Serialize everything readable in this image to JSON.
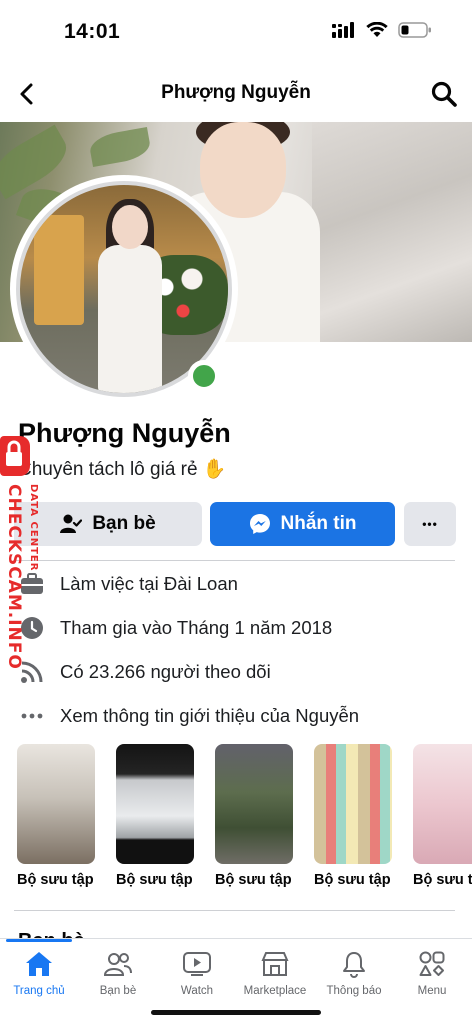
{
  "status_bar": {
    "time": "14:01"
  },
  "header": {
    "title": "Phượng Nguyễn"
  },
  "profile": {
    "name": "Phượng Nguyễn",
    "bio": "Chuyên tách lô giá rẻ ✋",
    "online": true
  },
  "actions": {
    "friends_label": "Bạn bè",
    "message_label": "Nhắn tin",
    "more_label": "•••"
  },
  "info": {
    "work": "Làm việc tại Đài Loan",
    "joined": "Tham gia vào Tháng 1 năm 2018",
    "followers": "Có 23.266 người theo dõi",
    "see_about": "Xem thông tin giới thiệu của Nguyễn"
  },
  "collections": [
    {
      "label": "Bộ sưu tập"
    },
    {
      "label": "Bộ sưu tập"
    },
    {
      "label": "Bộ sưu tập"
    },
    {
      "label": "Bộ sưu tập"
    },
    {
      "label": "Bộ sưu tập"
    }
  ],
  "friends_section": {
    "title": "Bạn bè"
  },
  "bottom_nav": {
    "items": [
      {
        "label": "Trang chủ",
        "icon": "home-icon",
        "active": true
      },
      {
        "label": "Bạn bè",
        "icon": "friends-icon",
        "active": false
      },
      {
        "label": "Watch",
        "icon": "watch-icon",
        "active": false
      },
      {
        "label": "Marketplace",
        "icon": "marketplace-icon",
        "active": false
      },
      {
        "label": "Thông báo",
        "icon": "bell-icon",
        "active": false
      },
      {
        "label": "Menu",
        "icon": "menu-icon",
        "active": false
      }
    ]
  },
  "watermark": {
    "text": "CHECKSCAM.INFO",
    "sub": "DATA CENTER"
  },
  "colors": {
    "accent": "#1b74e4",
    "online": "#42a54a",
    "watermark": "#e62b2b"
  }
}
